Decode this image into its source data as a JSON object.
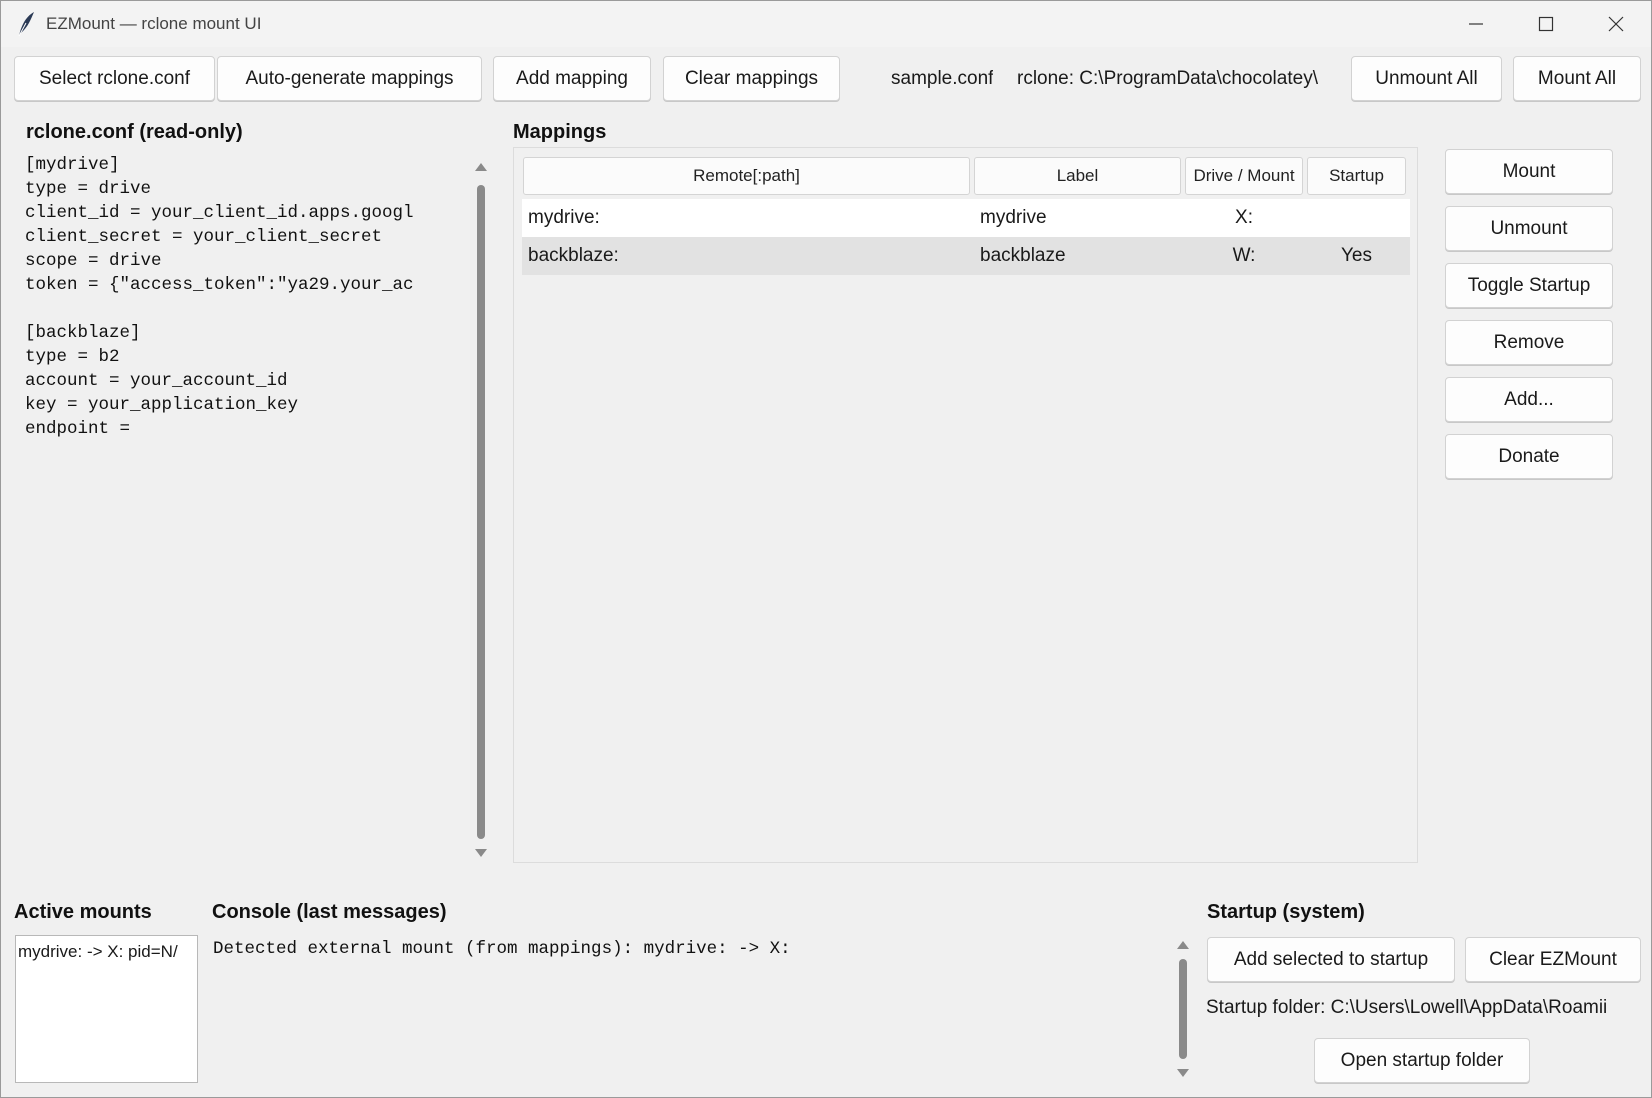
{
  "window": {
    "title": "EZMount — rclone mount UI"
  },
  "toolbar": {
    "select_conf": "Select rclone.conf",
    "auto_generate": "Auto-generate mappings",
    "add_mapping": "Add mapping",
    "clear_mappings": "Clear mappings",
    "conf_name": "sample.conf",
    "rclone_path": "rclone: C:\\ProgramData\\chocolatey\\",
    "unmount_all": "Unmount All",
    "mount_all": "Mount All"
  },
  "config": {
    "heading": "rclone.conf (read-only)",
    "lines": [
      "[mydrive]",
      "type = drive",
      "client_id = your_client_id.apps.googl",
      "client_secret = your_client_secret",
      "scope = drive",
      "token = {\"access_token\":\"ya29.your_ac",
      "",
      "[backblaze]",
      "type = b2",
      "account = your_account_id",
      "key = your_application_key",
      "endpoint ="
    ]
  },
  "mappings": {
    "heading": "Mappings",
    "columns": [
      "Remote[:path]",
      "Label",
      "Drive / Mount",
      "Startup"
    ],
    "rows": [
      {
        "remote": "mydrive:",
        "label": "mydrive",
        "drive": "X:",
        "startup": ""
      },
      {
        "remote": "backblaze:",
        "label": "backblaze",
        "drive": "W:",
        "startup": "Yes"
      }
    ],
    "selected_row": 1
  },
  "actions": {
    "mount": "Mount",
    "unmount": "Unmount",
    "toggle_startup": "Toggle Startup",
    "remove": "Remove",
    "add": "Add...",
    "donate": "Donate"
  },
  "active_mounts": {
    "heading": "Active mounts",
    "items": [
      "mydrive: -> X:  pid=N/"
    ]
  },
  "console": {
    "heading": "Console (last messages)",
    "lines": [
      "Detected external mount (from mappings): mydrive: -> X:"
    ]
  },
  "startup": {
    "heading": "Startup (system)",
    "add_selected": "Add selected to startup",
    "clear_ezmount": "Clear EZMount",
    "folder_text": "Startup folder: C:\\Users\\Lowell\\AppData\\Roamii",
    "open_folder": "Open startup folder"
  },
  "icons": {
    "app": "feather-icon",
    "minimize": "minimize-icon",
    "maximize": "maximize-icon",
    "close": "close-icon"
  }
}
